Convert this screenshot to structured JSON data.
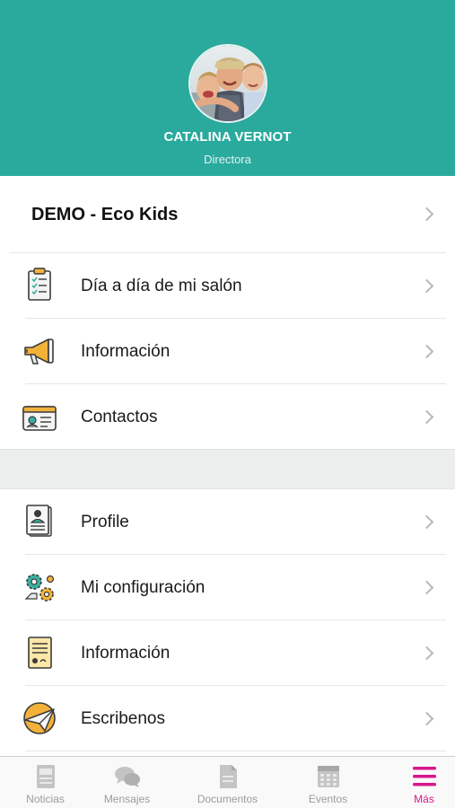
{
  "profile": {
    "name": "CATALINA VERNOT",
    "role": "Directora"
  },
  "school": {
    "name": "DEMO - Eco Kids"
  },
  "menu_section_1": [
    {
      "label": "Día a día de mi salón",
      "icon": "clipboard-checklist-icon"
    },
    {
      "label": "Información",
      "icon": "megaphone-icon"
    },
    {
      "label": "Contactos",
      "icon": "contact-card-icon"
    }
  ],
  "menu_section_2": [
    {
      "label": "Profile",
      "icon": "profile-document-icon"
    },
    {
      "label": "Mi configuración",
      "icon": "gears-icon"
    },
    {
      "label": "Información",
      "icon": "certificate-document-icon"
    },
    {
      "label": "Escribenos",
      "icon": "paper-plane-icon"
    }
  ],
  "tabbar": {
    "tabs": [
      {
        "label": "Noticias",
        "icon": "newspaper-icon"
      },
      {
        "label": "Mensajes",
        "icon": "chat-bubbles-icon"
      },
      {
        "label": "Documentos",
        "icon": "document-icon"
      },
      {
        "label": "Eventos",
        "icon": "calendar-icon"
      },
      {
        "label": "Más",
        "icon": "hamburger-menu-icon"
      }
    ],
    "active_color": "#d6188c",
    "inactive_color": "#9c9c9c"
  },
  "colors": {
    "header_bg": "#2aaa9d",
    "gap_bg": "#eceeee"
  }
}
